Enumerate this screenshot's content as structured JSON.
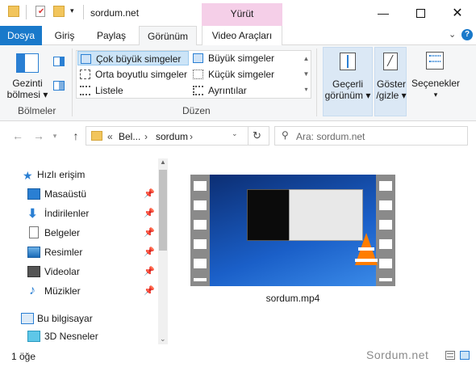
{
  "window": {
    "title": "sordum.net",
    "context_tab": "Yürüt"
  },
  "tabs": {
    "file": "Dosya",
    "home": "Giriş",
    "share": "Paylaş",
    "view": "Görünüm",
    "video": "Video Araçları"
  },
  "ribbon": {
    "panes_btn": "Gezinti bölmesi",
    "panes_line1": "Gezinti",
    "panes_line2": "bölmesi",
    "group_panes": "Bölmeler",
    "layout": {
      "xl": "Çok büyük simgeler",
      "large": "Büyük simgeler",
      "medium": "Orta boyutlu simgeler",
      "small": "Küçük simgeler",
      "list": "Listele",
      "details": "Ayrıntılar"
    },
    "group_layout": "Düzen",
    "current_view_line1": "Geçerli",
    "current_view_line2": "görünüm",
    "showhide_line1": "Göster",
    "showhide_line2": "/gizle",
    "options": "Seçenekler"
  },
  "address": {
    "crumb1": "Bel...",
    "crumb2": "sordum",
    "search_placeholder": "Ara: sordum.net"
  },
  "nav": {
    "quick": "Hızlı erişim",
    "items": [
      "Masaüstü",
      "İndirilenler",
      "Belgeler",
      "Resimler",
      "Videolar",
      "Müzikler"
    ],
    "pc": "Bu bilgisayar",
    "objects": "3D Nesneler"
  },
  "file": {
    "name": "sordum.mp4"
  },
  "status": {
    "count": "1 öğe",
    "watermark": "Sordum.net"
  }
}
